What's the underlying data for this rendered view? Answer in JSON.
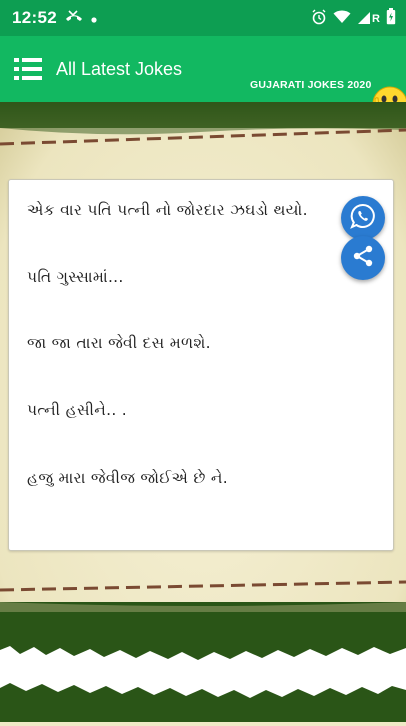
{
  "status_bar": {
    "time": "12:52",
    "left_icons": [
      "missed-call-icon",
      "notification-dot-icon"
    ],
    "right_icons": [
      "alarm-icon",
      "wifi-icon",
      "signal-icon",
      "battery-icon"
    ],
    "network_label": "R"
  },
  "app_bar": {
    "title": "All Latest Jokes",
    "brand": "GUJARATI JOKES 2020"
  },
  "joke": {
    "lines": [
      "એક વાર પતિ પત્ની નો જોરદાર ઝઘડો થયો.",
      "પતિ ગુસ્સામાં...",
      "જા જા તારા જેવી દસ મળશે.",
      "પત્ની હસીને.. .",
      "હજુ મારા જેવીજ જોઈએ છે ને."
    ]
  },
  "actions": {
    "whatsapp": "whatsapp-icon",
    "share": "share-icon"
  },
  "colors": {
    "status_bar": "#0d9e52",
    "app_bar": "#12b861",
    "fab": "#2a7bd1",
    "background_cream": "#efe9c6",
    "background_green": "#2f5a1c"
  }
}
